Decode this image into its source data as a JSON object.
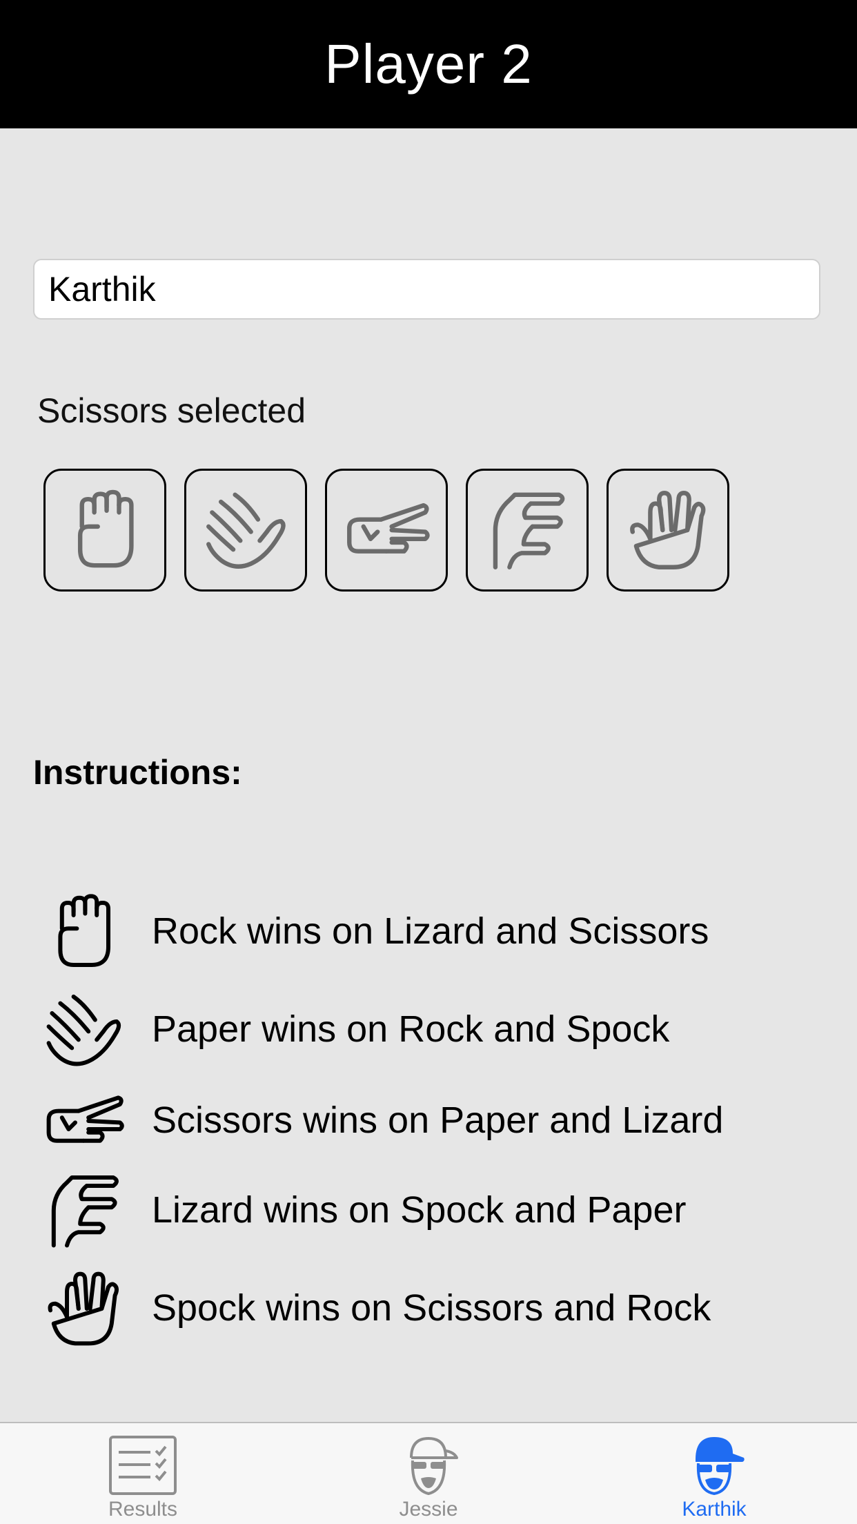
{
  "nav": {
    "title": "Player 2"
  },
  "player": {
    "name": "Karthik"
  },
  "selection": {
    "status": "Scissors selected",
    "selected": "scissors"
  },
  "choices": [
    {
      "id": "rock",
      "icon": "rock-hand-icon"
    },
    {
      "id": "paper",
      "icon": "paper-hand-icon"
    },
    {
      "id": "scissors",
      "icon": "scissors-hand-icon"
    },
    {
      "id": "lizard",
      "icon": "lizard-hand-icon"
    },
    {
      "id": "spock",
      "icon": "spock-hand-icon"
    }
  ],
  "instructions": {
    "heading": "Instructions:",
    "rules": [
      {
        "icon": "rock-hand-icon",
        "text": "Rock wins on Lizard and Scissors"
      },
      {
        "icon": "paper-hand-icon",
        "text": "Paper wins on Rock and Spock"
      },
      {
        "icon": "scissors-hand-icon",
        "text": "Scissors wins on Paper and Lizard"
      },
      {
        "icon": "lizard-hand-icon",
        "text": "Lizard wins on Spock and Paper"
      },
      {
        "icon": "spock-hand-icon",
        "text": "Spock wins on Scissors and Rock"
      }
    ]
  },
  "tabs": [
    {
      "label": "Results",
      "icon": "results-checklist-icon",
      "active": false
    },
    {
      "label": "Jessie",
      "icon": "player-avatar-icon",
      "active": false
    },
    {
      "label": "Karthik",
      "icon": "player-avatar-icon",
      "active": true
    }
  ],
  "colors": {
    "accent": "#1f6cf2",
    "navbar": "#000000",
    "background": "#e6e6e6",
    "inactive_tab": "#8e8e8e"
  }
}
